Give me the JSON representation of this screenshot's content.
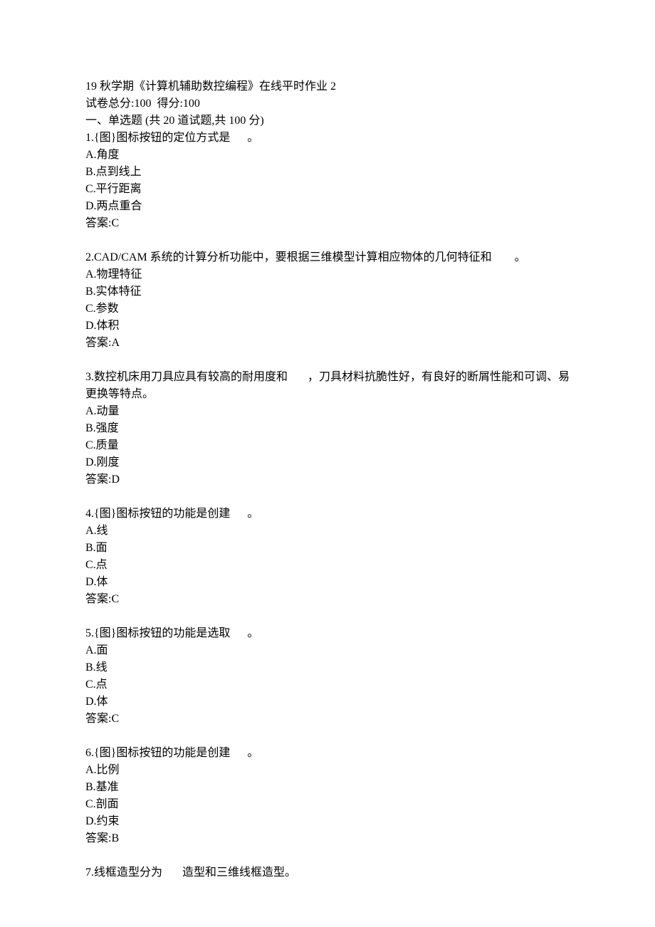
{
  "header": {
    "title": "19 秋学期《计算机辅助数控编程》在线平时作业 2",
    "scoreline": "试卷总分:100  得分:100",
    "section": "一、单选题 (共 20 道试题,共 100 分)"
  },
  "questions": [
    {
      "stem": "1.{图}图标按钮的定位方式是      。",
      "options": [
        "A.角度",
        "B.点到线上",
        "C.平行距离",
        "D.两点重合"
      ],
      "answer": "答案:C"
    },
    {
      "stem": "2.CAD/CAM 系统的计算分析功能中，要根据三维模型计算相应物体的几何特征和        。",
      "options": [
        "A.物理特征",
        "B.实体特征",
        "C.参数",
        "D.体积"
      ],
      "answer": "答案:A"
    },
    {
      "stem": "3.数控机床用刀具应具有较高的耐用度和       ，刀具材料抗脆性好，有良好的断屑性能和可调、易更换等特点。",
      "options": [
        "A.动量",
        "B.强度",
        "C.质量",
        "D.刚度"
      ],
      "answer": "答案:D"
    },
    {
      "stem": "4.{图}图标按钮的功能是创建      。",
      "options": [
        "A.线",
        "B.面",
        "C.点",
        "D.体"
      ],
      "answer": "答案:C"
    },
    {
      "stem": "5.{图}图标按钮的功能是选取      。",
      "options": [
        "A.面",
        "B.线",
        "C.点",
        "D.体"
      ],
      "answer": "答案:C"
    },
    {
      "stem": "6.{图}图标按钮的功能是创建      。",
      "options": [
        "A.比例",
        "B.基准",
        "C.剖面",
        "D.约束"
      ],
      "answer": "答案:B"
    },
    {
      "stem": "7.线框造型分为       造型和三维线框造型。",
      "options": [],
      "answer": ""
    }
  ]
}
